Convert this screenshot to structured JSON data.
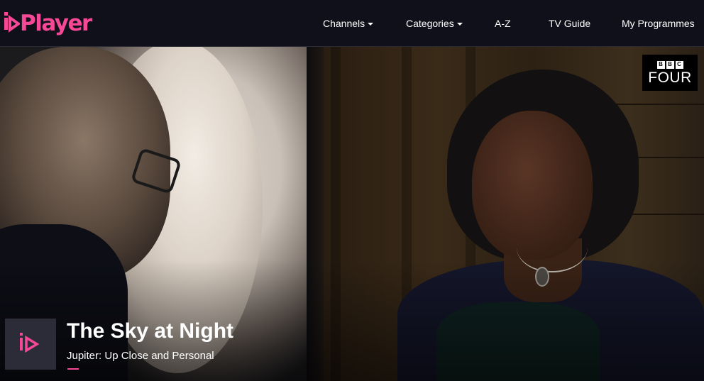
{
  "header": {
    "logo_text": "Player",
    "logo_color": "#f54997",
    "nav": [
      {
        "label": "Channels",
        "has_dropdown": true
      },
      {
        "label": "Categories",
        "has_dropdown": true
      },
      {
        "label": "A-Z",
        "has_dropdown": false
      },
      {
        "label": "TV Guide",
        "has_dropdown": false
      },
      {
        "label": "My Programmes",
        "has_dropdown": false
      }
    ]
  },
  "hero": {
    "channel": {
      "blocks": [
        "B",
        "B",
        "C"
      ],
      "name": "FOUR"
    },
    "title": "The Sky at Night",
    "subtitle": "Jupiter: Up Close and Personal",
    "play_icon": "play-icon",
    "accent_color": "#f54997"
  }
}
